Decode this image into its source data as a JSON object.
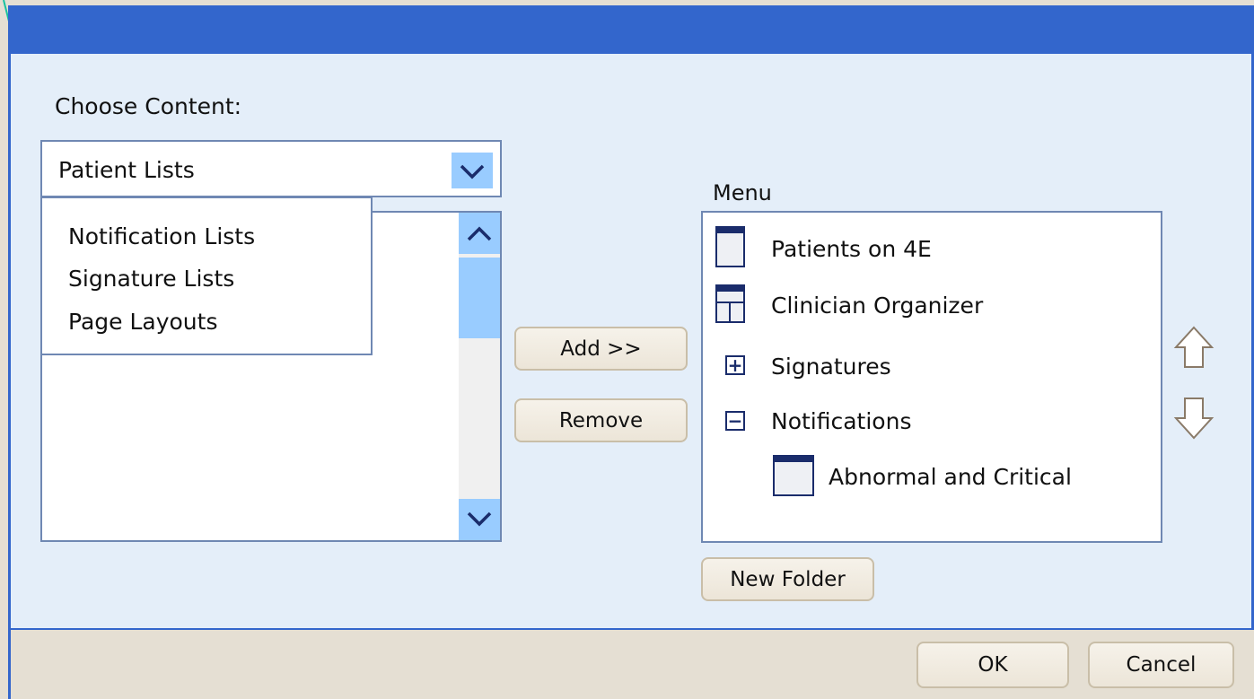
{
  "dialog": {
    "choose_label": "Choose Content:",
    "dropdown_value": "Patient Lists",
    "dropdown_options": [
      "Notification Lists",
      "Signature Lists",
      "Page Layouts"
    ],
    "add_label": "Add >>",
    "remove_label": "Remove",
    "menu_label": "Menu",
    "menu_items": [
      "Patients on 4E",
      "Clinician Organizer",
      "Signatures",
      "Notifications",
      "Abnormal and Critical"
    ],
    "new_folder_label": "New Folder",
    "ok_label": "OK",
    "cancel_label": "Cancel"
  },
  "colors": {
    "titlebar": "#3366cc",
    "body": "#e4eef9",
    "footer": "#e5dfd3",
    "scrollbar_accent": "#99ccff"
  }
}
